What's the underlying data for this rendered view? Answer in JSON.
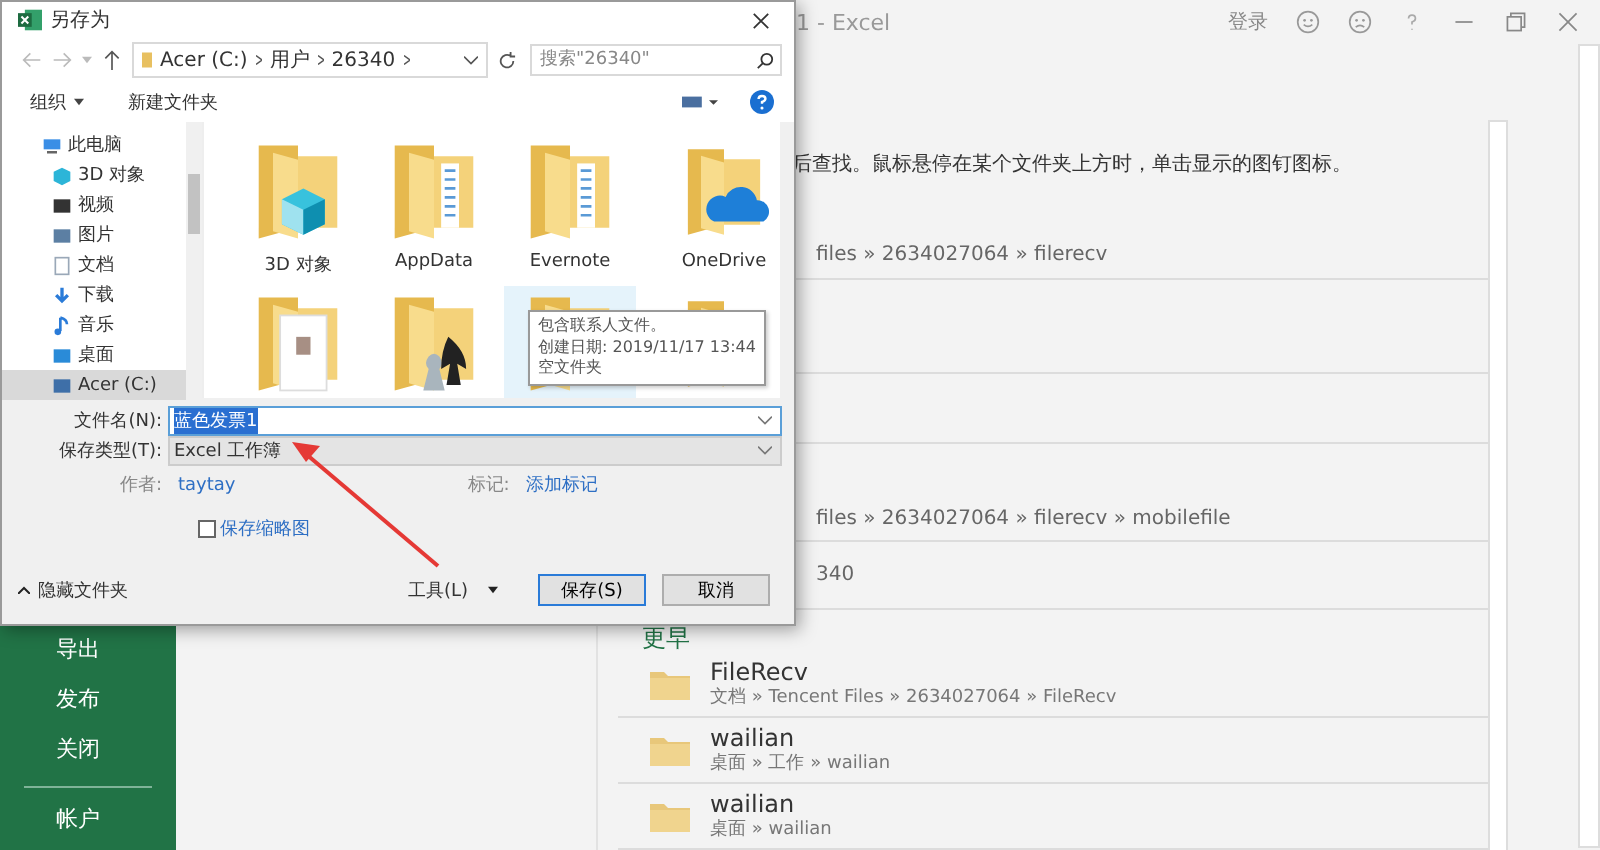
{
  "excel": {
    "title": "1 - Excel",
    "signin": "登录",
    "hint": "后查找。鼠标悬停在某个文件夹上方时，单击显示的图钉图标。",
    "sidebar": [
      {
        "label": "导出"
      },
      {
        "label": "发布"
      },
      {
        "label": "关闭"
      },
      {
        "label": "帐户"
      }
    ],
    "recent": [
      {
        "path": "files » 2634027064 » filerecv"
      },
      {
        "path": "files » 2634027064 » filerecv » mobilefile"
      },
      {
        "path": "340"
      }
    ],
    "earlier": {
      "title": "更早",
      "items": [
        {
          "name": "FileRecv",
          "path": "文档 » Tencent Files » 2634027064 » FileRecv"
        },
        {
          "name": "wailian",
          "path": "桌面 » 工作 » wailian"
        },
        {
          "name": "wailian",
          "path": "桌面 » wailian"
        }
      ]
    }
  },
  "dialog": {
    "title": "另存为",
    "address": [
      "Acer (C:)",
      "用户",
      "26340"
    ],
    "search": {
      "placeholder": "搜索\"26340\""
    },
    "toolbar": {
      "organize": "组织",
      "new_folder": "新建文件夹"
    },
    "nav": [
      {
        "label": "此电脑",
        "kind": "pc",
        "selected": false,
        "children": [
          {
            "label": "3D 对象",
            "kind": "cube",
            "selected": false
          },
          {
            "label": "视频",
            "kind": "video",
            "selected": false
          },
          {
            "label": "图片",
            "kind": "picture",
            "selected": false
          },
          {
            "label": "文档",
            "kind": "doc",
            "selected": false
          },
          {
            "label": "下载",
            "kind": "download",
            "selected": false
          },
          {
            "label": "音乐",
            "kind": "music",
            "selected": false
          },
          {
            "label": "桌面",
            "kind": "desktop",
            "selected": false
          },
          {
            "label": "Acer (C:)",
            "kind": "drive",
            "selected": true
          }
        ]
      }
    ],
    "folders": [
      {
        "label": "3D 对象",
        "kind": "cube",
        "selected": false
      },
      {
        "label": "AppData",
        "kind": "docs",
        "selected": false
      },
      {
        "label": "Evernote",
        "kind": "docs",
        "selected": false
      },
      {
        "label": "OneDrive",
        "kind": "cloud",
        "selected": false
      },
      {
        "kind": "contacts",
        "selected": false
      },
      {
        "kind": "games",
        "selected": false
      },
      {
        "kind": "plain",
        "selected": true
      },
      {
        "kind": "plain",
        "selected": false
      }
    ],
    "tooltip": [
      "包含联系人文件。",
      "创建日期: 2019/11/17 13:44",
      "空文件夹"
    ],
    "filename": {
      "label": "文件名(N):",
      "value": "蓝色发票1"
    },
    "filetype": {
      "label": "保存类型(T):",
      "value": "Excel 工作簿"
    },
    "author": {
      "label": "作者:",
      "value": "taytay"
    },
    "tags": {
      "label": "标记:",
      "value": "添加标记"
    },
    "thumbnail": {
      "label": "保存缩略图",
      "checked": false
    },
    "hide_folders": "隐藏文件夹",
    "tools": "工具(L)",
    "buttons": [
      "保存(S)",
      "取消"
    ]
  }
}
